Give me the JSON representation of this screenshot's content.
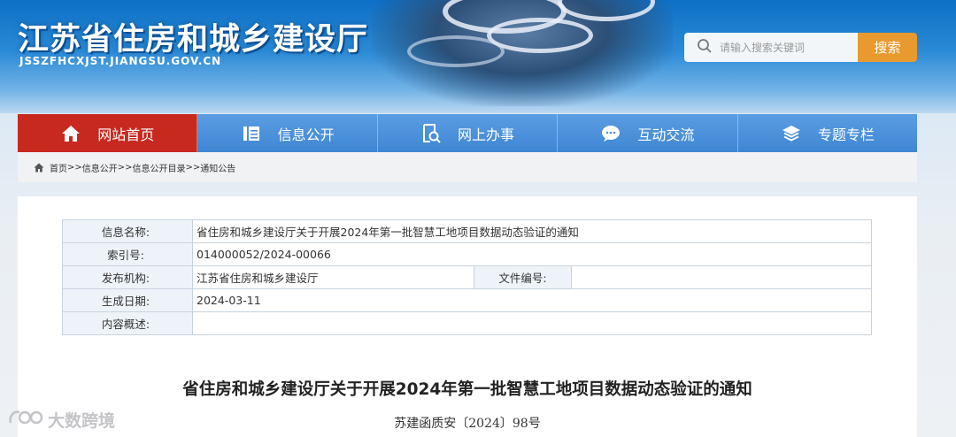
{
  "header": {
    "title": "江苏省住房和城乡建设厅",
    "domain": "JSSZFHCXJST.JIANGSU.GOV.CN",
    "search_placeholder": "请输入搜索关键词",
    "search_button": "搜索"
  },
  "nav": {
    "items": [
      {
        "label": "网站首页",
        "icon": "home-icon",
        "active": true
      },
      {
        "label": "信息公开",
        "icon": "document-icon",
        "active": false
      },
      {
        "label": "网上办事",
        "icon": "search-doc-icon",
        "active": false
      },
      {
        "label": "互动交流",
        "icon": "chat-icon",
        "active": false
      },
      {
        "label": "专题专栏",
        "icon": "layers-icon",
        "active": false
      }
    ]
  },
  "breadcrumb": {
    "items": [
      "首页",
      "信息公开",
      "信息公开目录",
      "通知公告"
    ],
    "separator": ">>"
  },
  "info_table": {
    "name_label": "信息名称:",
    "name_value": "省住房和城乡建设厅关于开展2024年第一批智慧工地项目数据动态验证的通知",
    "index_label": "索引号:",
    "index_value": "014000052/2024-00066",
    "publisher_label": "发布机构:",
    "publisher_value": "江苏省住房和城乡建设厅",
    "docno_label": "文件编号:",
    "docno_value": "",
    "date_label": "生成日期:",
    "date_value": "2024-03-11",
    "summary_label": "内容概述:",
    "summary_value": ""
  },
  "document": {
    "title": "省住房和城乡建设厅关于开展2024年第一批智慧工地项目数据动态验证的通知",
    "number": "苏建函质安〔2024〕98号"
  },
  "watermark": {
    "text": "大数跨境"
  },
  "colors": {
    "nav_active": "#c8291f",
    "nav_bg": "#4a8fd8",
    "search_button": "#e89a2e"
  }
}
